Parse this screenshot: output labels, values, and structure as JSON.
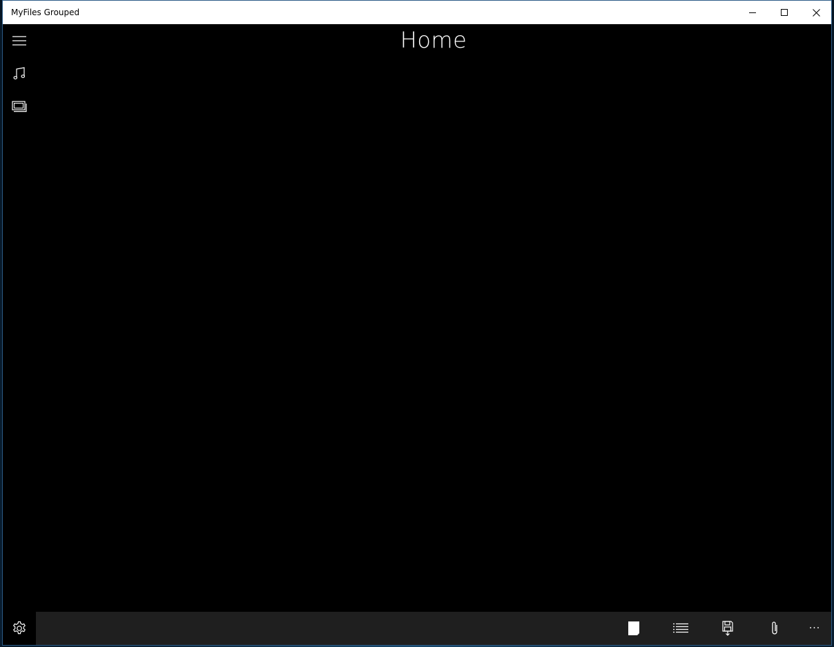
{
  "window": {
    "title": "MyFiles Grouped"
  },
  "page": {
    "title": "Home"
  },
  "nav": {
    "items": [
      {
        "icon": "hamburger-icon"
      },
      {
        "icon": "music-icon"
      },
      {
        "icon": "photos-icon"
      },
      {
        "icon": "gear-icon"
      }
    ]
  },
  "commandbar": {
    "buttons": [
      {
        "icon": "page-icon"
      },
      {
        "icon": "list-icon"
      },
      {
        "icon": "save-icon"
      },
      {
        "icon": "attach-icon"
      }
    ],
    "more_label": "···"
  },
  "colors": {
    "background": "#000000",
    "titlebar": "#ffffff",
    "commandbar": "#1f1f1f",
    "foreground": "#ffffff",
    "window_border": "#2b5b86"
  }
}
